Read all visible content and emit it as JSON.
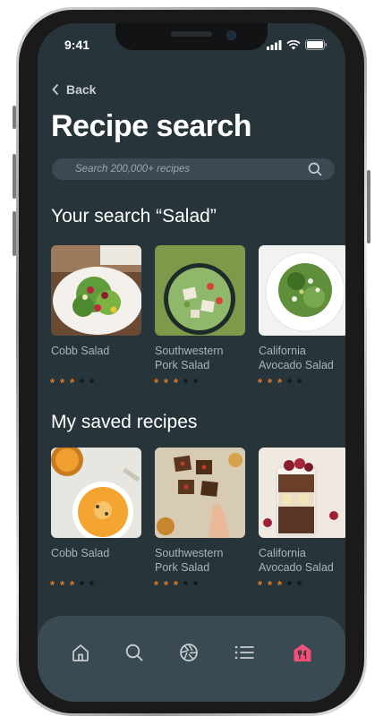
{
  "status": {
    "time": "9:41"
  },
  "nav": {
    "back_label": "Back"
  },
  "title": "Recipe search",
  "search": {
    "placeholder": "Search 200,000+ recipes",
    "value": ""
  },
  "sections": {
    "results": {
      "title": "Your search “Salad”",
      "items": [
        {
          "name": "Cobb Salad",
          "rating": 3,
          "max": 5
        },
        {
          "name": "Southwestern Pork Salad",
          "rating": 3,
          "max": 5
        },
        {
          "name": "California Avocado Salad",
          "rating": 3,
          "max": 5
        }
      ]
    },
    "saved": {
      "title": "My saved recipes",
      "items": [
        {
          "name": "Cobb Salad",
          "rating": 3,
          "max": 5
        },
        {
          "name": "Southwestern Pork Salad",
          "rating": 3,
          "max": 5
        },
        {
          "name": "California Avocado Salad",
          "rating": 3,
          "max": 5
        }
      ]
    }
  },
  "tabbar": {
    "items": [
      {
        "icon": "home-icon",
        "active": false
      },
      {
        "icon": "search-icon",
        "active": false
      },
      {
        "icon": "aperture-icon",
        "active": false
      },
      {
        "icon": "list-icon",
        "active": false
      },
      {
        "icon": "restaurant-icon",
        "active": true
      }
    ]
  },
  "colors": {
    "background": "#27343a",
    "search_bg": "#3b4a52",
    "tabbar_bg": "#3a4a52",
    "star_on": "#e07b2a",
    "star_off": "#0d1418",
    "accent": "#f0507a"
  }
}
